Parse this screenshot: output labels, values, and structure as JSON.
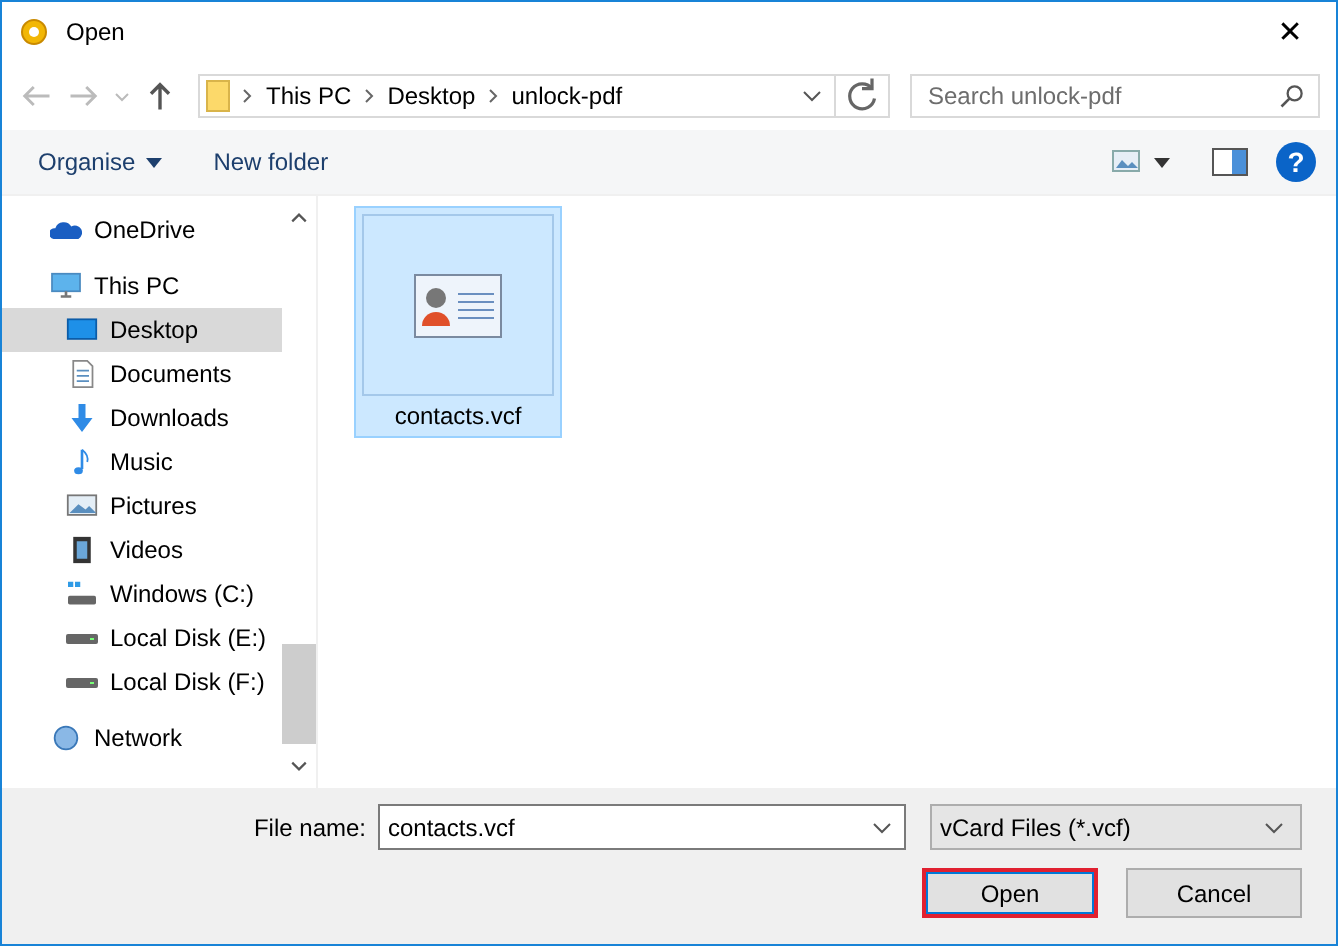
{
  "window": {
    "title": "Open",
    "close": "✕"
  },
  "nav": {
    "breadcrumb": [
      "This PC",
      "Desktop",
      "unlock-pdf"
    ],
    "search": {
      "placeholder": "Search unlock-pdf"
    }
  },
  "toolbar": {
    "organise": "Organise",
    "new_folder": "New folder",
    "help": "?"
  },
  "sidebar": {
    "items": [
      {
        "label": "OneDrive",
        "kind": "cloud",
        "selected": false
      },
      {
        "label": "This PC",
        "kind": "pc",
        "selected": false,
        "children": [
          {
            "label": "Desktop",
            "kind": "desktop",
            "selected": true
          },
          {
            "label": "Documents",
            "kind": "documents",
            "selected": false
          },
          {
            "label": "Downloads",
            "kind": "downloads",
            "selected": false
          },
          {
            "label": "Music",
            "kind": "music",
            "selected": false
          },
          {
            "label": "Pictures",
            "kind": "pictures",
            "selected": false
          },
          {
            "label": "Videos",
            "kind": "videos",
            "selected": false
          },
          {
            "label": "Windows (C:)",
            "kind": "windrive",
            "selected": false
          },
          {
            "label": "Local Disk (E:)",
            "kind": "drive",
            "selected": false
          },
          {
            "label": "Local Disk (F:)",
            "kind": "drive",
            "selected": false
          }
        ]
      },
      {
        "label": "Network",
        "kind": "network",
        "selected": false
      }
    ]
  },
  "files": [
    {
      "name": "contacts.vcf",
      "selected": true
    }
  ],
  "footer": {
    "file_name_label": "File name:",
    "file_name": "contacts.vcf",
    "filter": "vCard Files (*.vcf)",
    "open": "Open",
    "cancel": "Cancel"
  }
}
